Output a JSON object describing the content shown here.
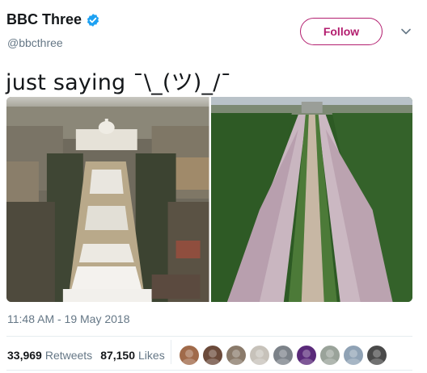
{
  "account": {
    "name": "BBC Three",
    "handle": "@bbcthree",
    "follow_label": "Follow"
  },
  "tweet": {
    "text": "just saying ¯\\_(ツ)_/¯",
    "timestamp": "11:48 AM - 19 May 2018"
  },
  "stats": {
    "retweets_count": "33,969",
    "retweets_label": "Retweets",
    "likes_count": "87,150",
    "likes_label": "Likes"
  },
  "avatars": [
    {
      "color": "#a06a4a"
    },
    {
      "color": "#6b4a3a"
    },
    {
      "color": "#8a7a6a"
    },
    {
      "color": "#c7c2ba"
    },
    {
      "color": "#7c8289"
    },
    {
      "color": "#5a2a7a"
    },
    {
      "color": "#9aa39a"
    },
    {
      "color": "#8fa2b5"
    },
    {
      "color": "#4a4a4a"
    }
  ],
  "colors": {
    "brand": "#b31e6f",
    "verified": "#1da1f2",
    "secondary_text": "#657786"
  },
  "icons": [
    "verified-badge-icon",
    "chevron-down-icon"
  ]
}
